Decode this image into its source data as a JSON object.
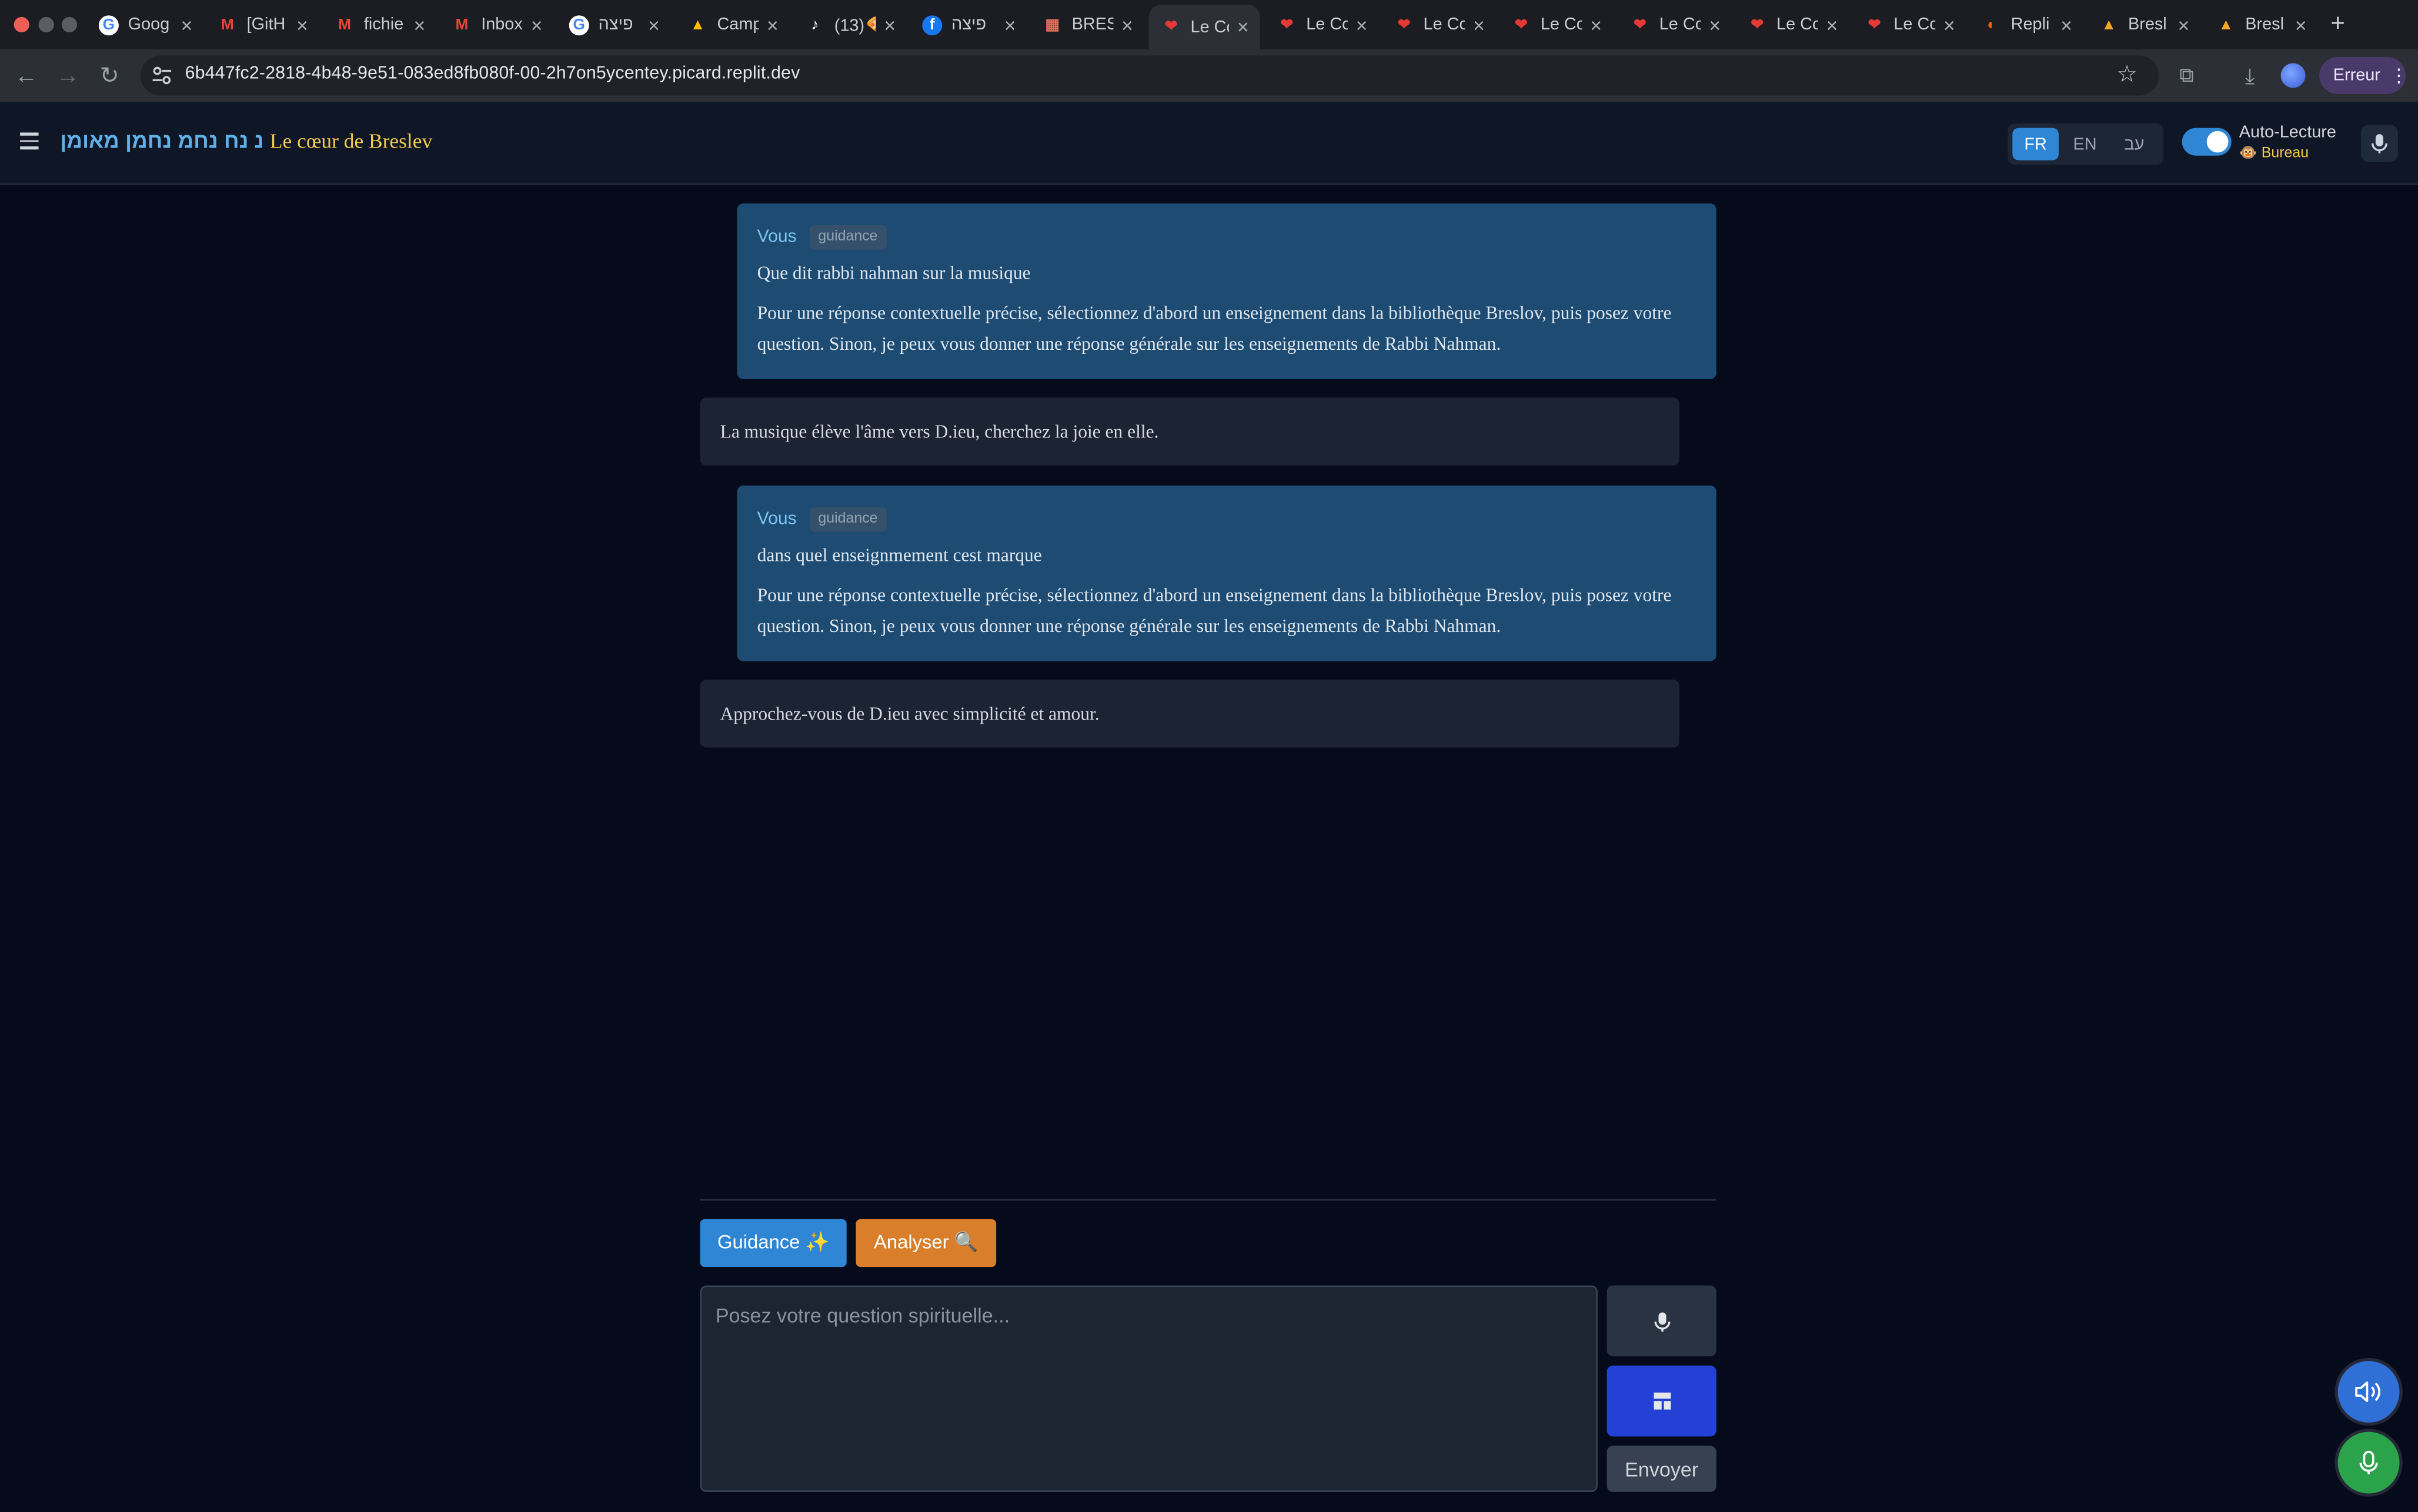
{
  "browser": {
    "tabs": [
      {
        "title": "Goog",
        "icon": "google-icon"
      },
      {
        "title": "[GitH",
        "icon": "gmail-icon"
      },
      {
        "title": "fichie",
        "icon": "gmail-icon"
      },
      {
        "title": "Inbox",
        "icon": "gmail-icon"
      },
      {
        "title": "פיצה",
        "icon": "google-icon"
      },
      {
        "title": "Camp",
        "icon": "google-ads-icon"
      },
      {
        "title": "(13)🍕",
        "icon": "tiktok-icon"
      },
      {
        "title": "פיצה",
        "icon": "facebook-icon"
      },
      {
        "title": "BRES",
        "icon": "app-icon"
      },
      {
        "title": "Le Cœ",
        "icon": "heart-icon",
        "active": true
      },
      {
        "title": "Le Cœ",
        "icon": "heart-icon"
      },
      {
        "title": "Le Cœ",
        "icon": "heart-icon"
      },
      {
        "title": "Le Cœ",
        "icon": "heart-icon"
      },
      {
        "title": "Le Cœ",
        "icon": "heart-icon"
      },
      {
        "title": "Le Cœ",
        "icon": "heart-icon"
      },
      {
        "title": "Le Cœ",
        "icon": "heart-icon"
      },
      {
        "title": "Repli",
        "icon": "replit-icon"
      },
      {
        "title": "Bresl",
        "icon": "flame-icon"
      },
      {
        "title": "Bresl",
        "icon": "flame-icon"
      }
    ],
    "new_tab_label": "+",
    "url": "6b447fc2-2818-4b48-9e51-083ed8fb080f-00-2h7on5ycentey.picard.replit.dev",
    "profile_status": "Erreur"
  },
  "app": {
    "hebrew_title": "נ נח נחמ נחמן מאומן",
    "brand_title": "Le cœur de Breslev",
    "languages": [
      {
        "code": "FR",
        "active": true
      },
      {
        "code": "EN",
        "active": false
      },
      {
        "code": "עב",
        "active": false
      }
    ],
    "auto_read": {
      "label": "Auto-Lecture",
      "sub": "🐵 Bureau",
      "enabled": true
    }
  },
  "chat": {
    "messages": [
      {
        "role": "user",
        "sender": "Vous",
        "badge": "guidance",
        "question": "Que dit rabbi nahman sur la musique",
        "note": "Pour une réponse contextuelle précise, sélectionnez d'abord un enseignement dans la bibliothèque Breslov, puis posez votre question. Sinon, je peux vous donner une réponse générale sur les enseignements de Rabbi Nahman."
      },
      {
        "role": "assistant",
        "text": "La musique élève l'âme vers D.ieu, cherchez la joie en elle."
      },
      {
        "role": "user",
        "sender": "Vous",
        "badge": "guidance",
        "question": "dans quel enseignmement cest marque",
        "note": "Pour une réponse contextuelle précise, sélectionnez d'abord un enseignement dans la bibliothèque Breslov, puis posez votre question. Sinon, je peux vous donner une réponse générale sur les enseignements de Rabbi Nahman."
      },
      {
        "role": "assistant",
        "text": "Approchez-vous de D.ieu avec simplicité et amour."
      }
    ]
  },
  "composer": {
    "mode_buttons": [
      {
        "label": "Guidance ✨",
        "color": "#2f86d4"
      },
      {
        "label": "Analyser 🔍",
        "color": "#d97f2b"
      }
    ],
    "placeholder": "Posez votre question spirituelle...",
    "value": "",
    "send_label": "Envoyer"
  },
  "colors": {
    "background": "#060b1c",
    "header": "#0f1726",
    "user_bubble": "#1e4b72",
    "bot_bubble": "#1c2433",
    "brand_gold": "#f2c94c",
    "accent_blue": "#2f86d4",
    "accent_orange": "#d97f2b",
    "fab_speaker": "#2f6fd6",
    "fab_mic": "#2aa34a"
  }
}
